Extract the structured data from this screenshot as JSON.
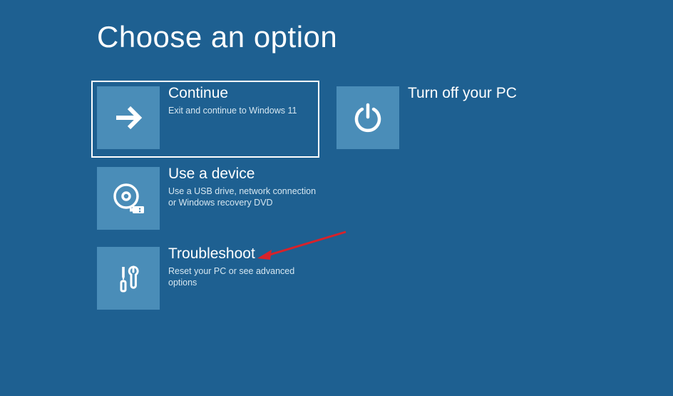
{
  "title": "Choose an option",
  "options": {
    "continue": {
      "label": "Continue",
      "description": "Exit and continue to Windows 11",
      "icon": "arrow-right-icon",
      "selected": true
    },
    "turnoff": {
      "label": "Turn off your PC",
      "description": "",
      "icon": "power-icon",
      "selected": false
    },
    "usedevice": {
      "label": "Use a device",
      "description": "Use a USB drive, network connection or Windows recovery DVD",
      "icon": "disc-usb-icon",
      "selected": false
    },
    "troubleshoot": {
      "label": "Troubleshoot",
      "description": "Reset your PC or see advanced options",
      "icon": "tools-icon",
      "selected": false
    }
  },
  "annotation": {
    "type": "arrow",
    "target": "troubleshoot",
    "color": "#d8222a"
  }
}
